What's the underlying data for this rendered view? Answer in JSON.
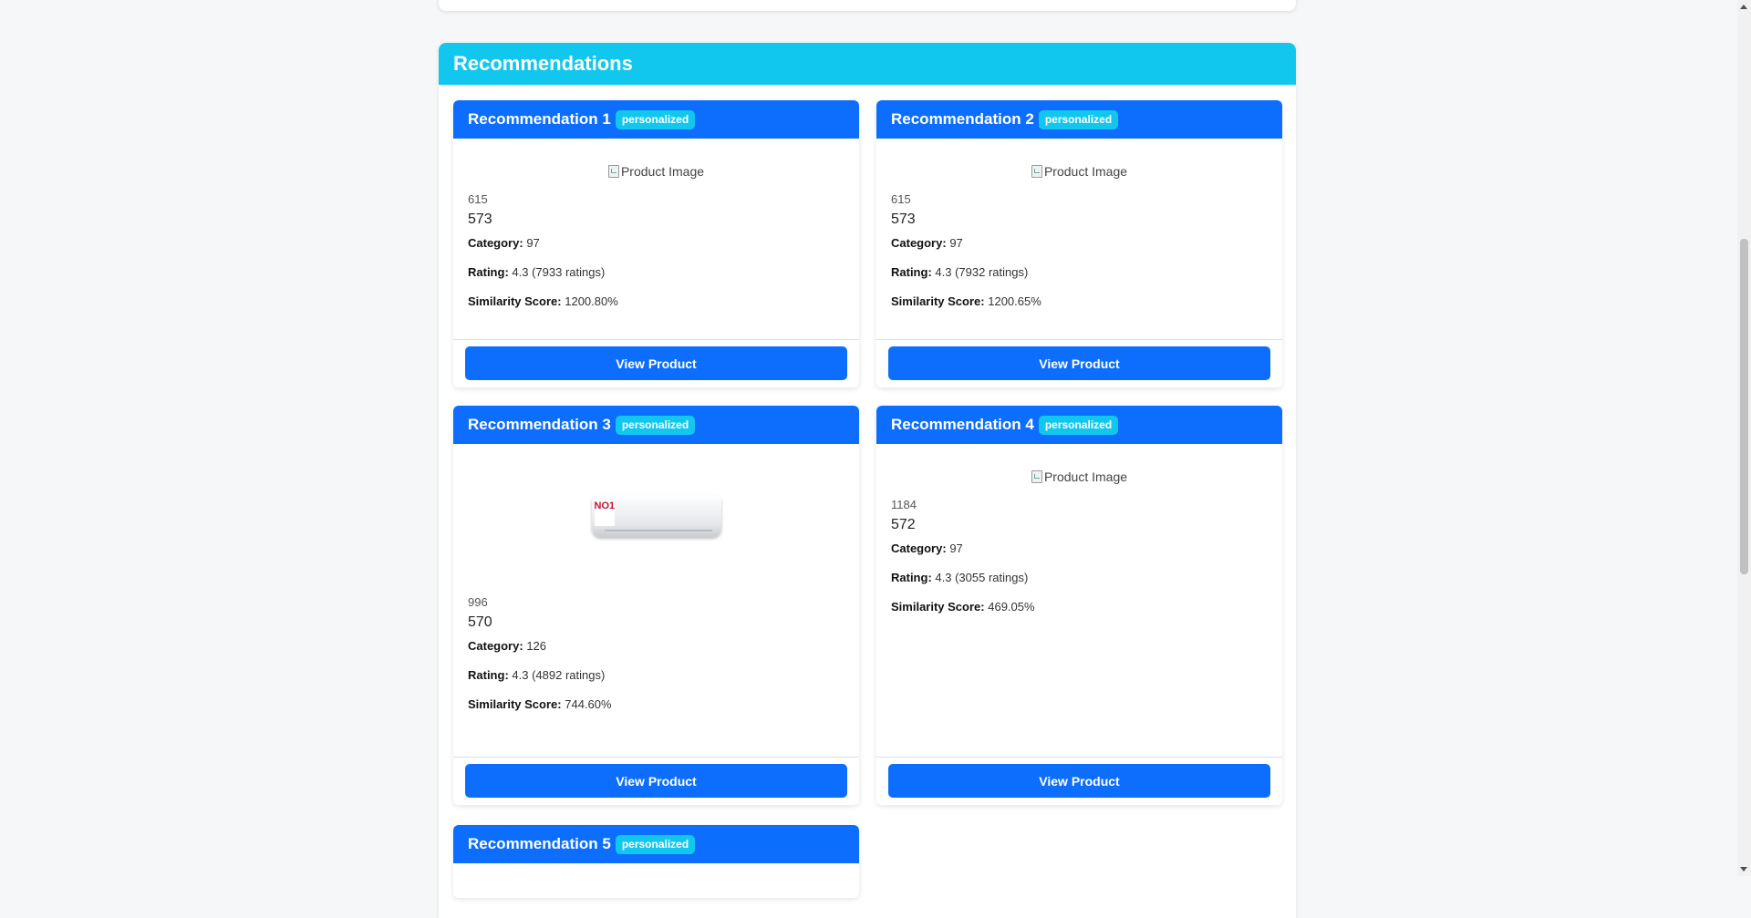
{
  "section": {
    "title": "Recommendations"
  },
  "button_label": "View Product",
  "image_alt": "Product Image",
  "labels": {
    "category": "Category:",
    "rating": "Rating:",
    "similarity": "Similarity Score:"
  },
  "cards": [
    {
      "title": "Recommendation 1",
      "badge": "personalized",
      "id": "615",
      "name": "573",
      "category": "97",
      "rating": "4.3 (7933 ratings)",
      "similarity": "1200.80%"
    },
    {
      "title": "Recommendation 2",
      "badge": "personalized",
      "id": "615",
      "name": "573",
      "category": "97",
      "rating": "4.3 (7932 ratings)",
      "similarity": "1200.65%"
    },
    {
      "title": "Recommendation 3",
      "badge": "personalized",
      "id": "996",
      "name": "570",
      "category": "126",
      "rating": "4.3 (4892 ratings)",
      "similarity": "744.60%"
    },
    {
      "title": "Recommendation 4",
      "badge": "personalized",
      "id": "1184",
      "name": "572",
      "category": "97",
      "rating": "4.3 (3055 ratings)",
      "similarity": "469.05%"
    },
    {
      "title": "Recommendation 5",
      "badge": "personalized"
    }
  ],
  "ac_image_text": "NO1"
}
